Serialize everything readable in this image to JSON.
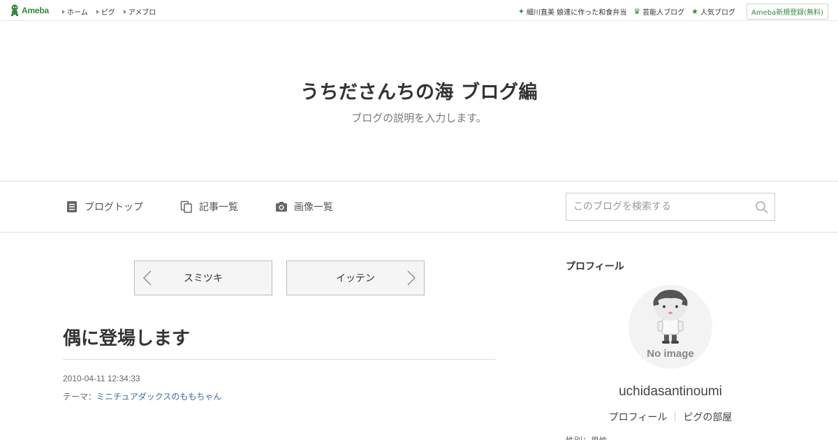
{
  "global_nav": {
    "logo_text": "Ameba",
    "left_links": [
      "ホーム",
      "ピグ",
      "アメブロ"
    ],
    "right_links": [
      {
        "icon": "sparkle-icon",
        "label": "細川直美 娘達に作った和食弁当"
      },
      {
        "icon": "crown-icon",
        "label": "芸能人ブログ"
      },
      {
        "icon": "star-icon",
        "label": "人気ブログ"
      }
    ],
    "register_label": "Ameba新規登録(無料)"
  },
  "header": {
    "title": "うちださんちの海 ブログ編",
    "description": "ブログの説明を入力します。"
  },
  "blog_nav": {
    "items": [
      {
        "icon": "document-icon",
        "label": "ブログトップ"
      },
      {
        "icon": "copy-icon",
        "label": "記事一覧"
      },
      {
        "icon": "camera-icon",
        "label": "画像一覧"
      }
    ],
    "search_placeholder": "このブログを検索する"
  },
  "pager": {
    "prev_label": "スミツキ",
    "next_label": "イッテン"
  },
  "entry": {
    "title": "偶に登場します",
    "date": "2010-04-11 12:34:33",
    "theme_prefix": "テーマ：",
    "theme_link": "ミニチュアダックスのももちゃん"
  },
  "sidebar": {
    "heading": "プロフィール",
    "avatar_text": "No image",
    "username": "uchidasantinoumi",
    "links": [
      "プロフィール",
      "ピグの部屋"
    ],
    "cut_text": "性別：男性"
  },
  "colors": {
    "brand_green": "#2d8c3c",
    "link_blue": "#3b6ea5"
  }
}
